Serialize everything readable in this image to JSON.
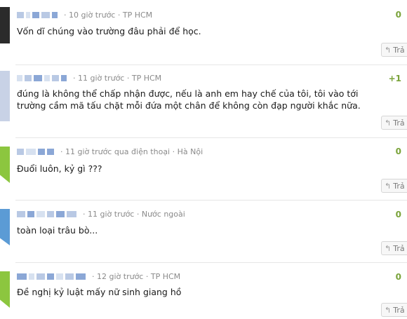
{
  "comments": [
    {
      "time": "10 giờ trước",
      "location": "TP HCM",
      "text": "Vốn dĩ chúng vào trường đâu phải để học.",
      "votes": "0",
      "reply_label": "Trả"
    },
    {
      "time": "11 giờ trước",
      "location": "TP HCM",
      "text": "đúng là không thể chấp nhận được, nếu là anh em hay chế của tôi, tôi vào tới trường cầm mã tấu chặt mỗi đứa một chân để không còn đạp người khắc nữa.",
      "votes": "+1",
      "reply_label": "Trả"
    },
    {
      "time": "11 giờ trước qua điện thoại",
      "location": "Hà Nội",
      "text": "Đuổi luôn, kỷ gì ???",
      "votes": "0",
      "reply_label": "Trả"
    },
    {
      "time": "11 giờ trước",
      "location": "Nước ngoài",
      "text": "toàn loại trâu bò...",
      "votes": "0",
      "reply_label": "Trả"
    },
    {
      "time": "12 giờ trước",
      "location": "TP HCM",
      "text": "Đề nghị kỷ luật mấy nữ sinh giang hồ",
      "votes": "0",
      "reply_label": "Trả"
    }
  ],
  "meta_separator": "·",
  "icons": {
    "reply": "reply-arrow-icon"
  },
  "colors": {
    "vote": "#7aa33a",
    "meta": "#8a8a8a"
  }
}
